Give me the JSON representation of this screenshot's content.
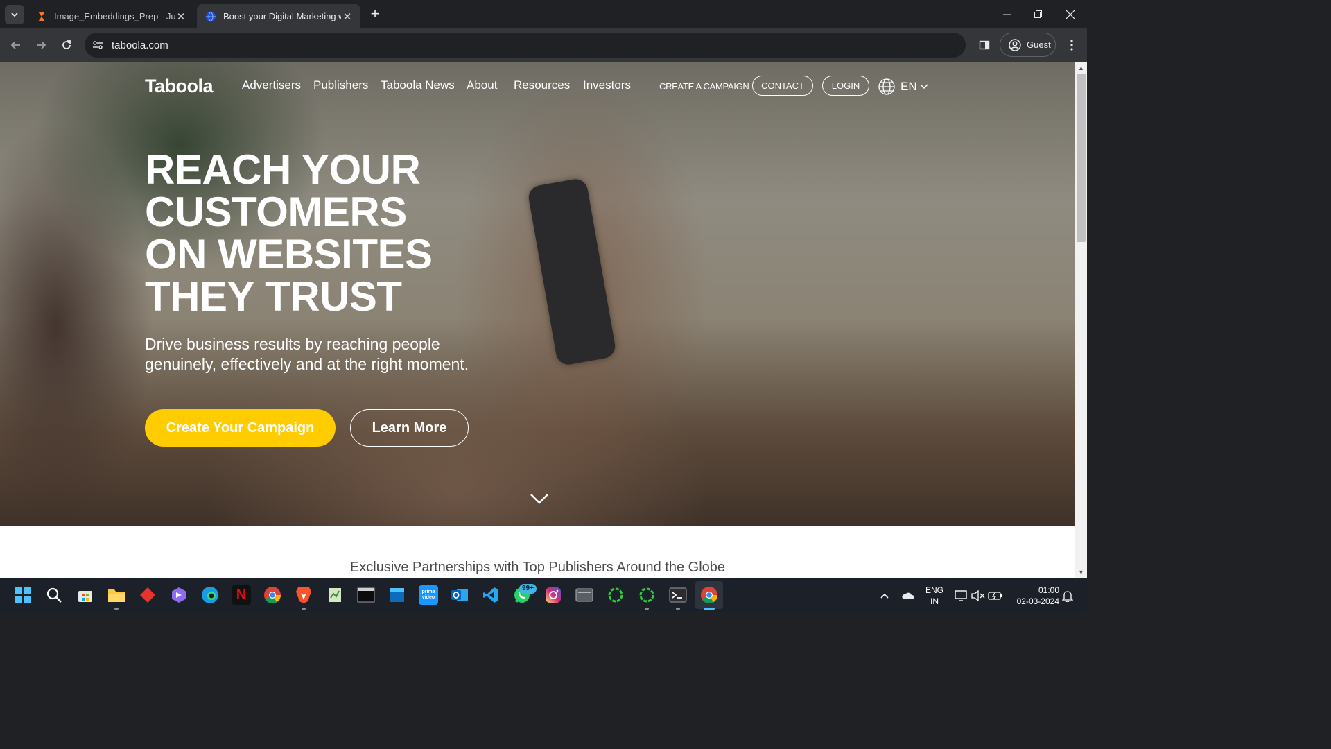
{
  "browser": {
    "tabs": [
      {
        "title": "Image_Embeddings_Prep - Jupy",
        "icon": "hourglass-icon"
      },
      {
        "title": "Boost your Digital Marketing w",
        "icon": "globe-icon"
      }
    ],
    "url": "taboola.com",
    "profile_label": "Guest"
  },
  "site": {
    "logo": "Taboola",
    "nav": [
      "Advertisers",
      "Publishers",
      "Taboola News",
      "About",
      "Resources",
      "Investors"
    ],
    "create_campaign_link": "CREATE A CAMPAIGN",
    "contact_button": "CONTACT",
    "login_button": "LOGIN",
    "language": "EN",
    "hero": {
      "title_lines": [
        "REACH YOUR",
        "CUSTOMERS",
        "ON WEBSITES",
        "THEY TRUST"
      ],
      "subtitle_line1": "Drive business results by reaching people",
      "subtitle_line2": "genuinely, effectively and at the right moment.",
      "primary_cta": "Create Your Campaign",
      "secondary_cta": "Learn More"
    },
    "partners_heading": "Exclusive Partnerships with Top Publishers Around the Globe"
  },
  "colors": {
    "accent_yellow": "#ffcc00",
    "browser_dark": "#202124",
    "toolbar": "#35363a"
  },
  "taskbar": {
    "whatsapp_badge": "99+",
    "language_top": "ENG",
    "language_bottom": "IN",
    "time": "01:00",
    "date": "02-03-2024"
  }
}
